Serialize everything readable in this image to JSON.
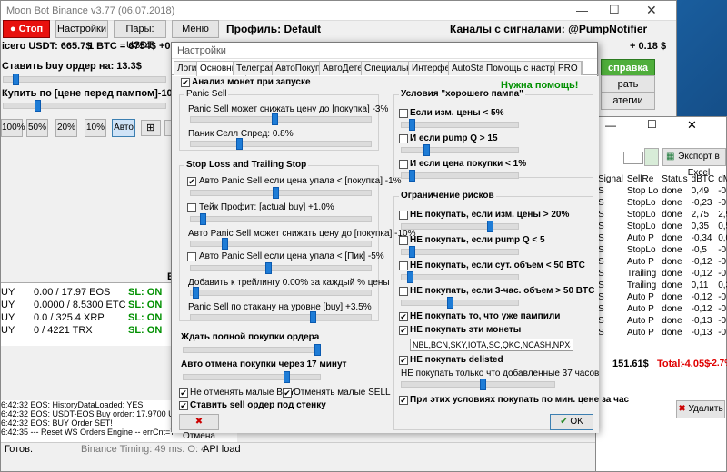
{
  "main": {
    "title": "Moon Bot Binance v3.77 (06.07.2018)",
    "stop_label": "Стоп",
    "settings_label": "Настройки",
    "pairs_label": "Пары: USDT",
    "menu_label": "Меню",
    "profile": "Профиль: Default",
    "signals": "Каналы с сигналами: @PumpNotifier",
    "balance": "icero USDT: 665.7$",
    "btc_rate": "1 BTC = 6754$ +0.0%",
    "right_top": "+ 0.18 $",
    "buy_order": "Ставить buy ордер на: 13.3$",
    "buy_price": "Купить по [цене перед пампом]-10.0%",
    "pct_buttons": [
      "100%",
      "50%",
      "20%",
      "10%",
      "Авто"
    ],
    "right_buttons": [
      "справка",
      "рать маркеты",
      "атегии"
    ],
    "side_letter": "E",
    "positions": [
      {
        "side": "UY",
        "amount": "0.00 / 17.97 EOS",
        "sl": "SL: ON"
      },
      {
        "side": "UY",
        "amount": "0.0000 / 8.5300 ETC",
        "sl": "SL: ON"
      },
      {
        "side": "UY",
        "amount": "0.0 / 325.4 XRP",
        "sl": "SL: ON"
      },
      {
        "side": "UY",
        "amount": "0 / 4221 TRX",
        "sl": "SL: ON"
      }
    ],
    "log": [
      "6:42:32 EOS: HistoryDataLoaded: YES",
      "6:42:32 EOS: USDT-EOS Buy order: 17.9700 USDT-EOS ra",
      "6:42:32 EOS: BUY Order SET!",
      "6:42:35 --- Reset WS Orders Engine -- errCnt=7"
    ],
    "status_ready": "Готов.",
    "timing": "Binance Timing: 49 ms.  O: 4",
    "api": "API load"
  },
  "dialog": {
    "title": "Настройки",
    "tabs": [
      "Логин",
      "Основные",
      "Телеграм",
      "АвтоПокупка",
      "АвтоДетект",
      "Специальные",
      "Интерфейс",
      "AutoStart",
      "Помощь с настройкой",
      "PRO"
    ],
    "active_tab": "Основные",
    "analyze": "Анализ монет при запуске",
    "need_help": "Нужна помощь!",
    "panic_sell_group": "Panic Sell",
    "panic_lower": "Panic Sell может снижать цену до [покупка] -3%",
    "panic_spread": "Паник Селл Спред: 0.8%",
    "sl_group": "Stop Loss and Trailing Stop",
    "auto_panic_1": "Авто Panic Sell если цена упала < [покупка] -1%",
    "take_profit": "Тейк Профит: [actual buy] +1.0%",
    "auto_panic_lower": "Авто Panic Sell может снижать цену до [покупка] -10%",
    "auto_panic_2": "Авто Panic Sell если цена упала < [Пик] -5%",
    "trailing_add": "Добавить к трейлингу 0.00% за каждый % цены",
    "panic_glass": "Panic Sell по стакану на уровне [buy] +3.5%",
    "wait_full": "Ждать полной покупки ордера",
    "auto_cancel": "Авто отмена покупки через 17 минут",
    "no_cancel_buy": "Не отменять малые BUY",
    "cancel_sell": "Отменять малые SELL",
    "sell_wall": "Ставить sell ордер под стенку",
    "good_pump": "Условия \"хорошего пампа\"",
    "if_change": "Если изм. цены < 5%",
    "if_pump": "И если pump Q > 15",
    "if_price": "И если цена покупки < 1%",
    "risk_group": "Ограничение рисков",
    "no_buy_change": "НЕ покупать, если изм. цены  > 20%",
    "no_buy_pump": "НЕ покупать, если pump Q < 5",
    "no_buy_vol": "НЕ покупать, если сут. объем < 50 BTC",
    "no_buy_3h": "НЕ покупать, если 3-час. объем > 50 BTC",
    "no_buy_pumped": "НЕ покупать то, что уже пампили",
    "no_buy_these": "НЕ покупать эти монеты",
    "coins": "NBL,BCN,SKY,IOTA,SC,QKC,NCASH,NPXS,KEY",
    "no_delisted": "НЕ покупать delisted",
    "only_new": "НЕ покупать только что добавленные 37 часов",
    "min_price": "При этих условиях покупать по мин. цене за час",
    "cancel_label": "Отмена",
    "ok_label": "OK"
  },
  "right_window": {
    "export_label": "Экспорт в Excel",
    "headers": [
      "Signal",
      "SellRe",
      "Status",
      "dBTC",
      "dMarke"
    ],
    "rows": [
      [
        "S",
        "Stop Lo",
        "done",
        "0,49",
        "-0,37"
      ],
      [
        "S",
        "StopLo",
        "done",
        "-0,23",
        "-0,37"
      ],
      [
        "S",
        "StopLo",
        "done",
        "2,75",
        "2,99"
      ],
      [
        "S",
        "StopLo",
        "done",
        "0,35",
        "0,57"
      ],
      [
        "S",
        "Auto P",
        "done",
        "-0,34",
        "0,03"
      ],
      [
        "S",
        "StopLo",
        "done",
        "-0,5",
        "-0,52"
      ],
      [
        "S",
        "Auto P",
        "done",
        "-0,12",
        "-0,12"
      ],
      [
        "S",
        "Trailing",
        "done",
        "-0,12",
        "-0,12"
      ],
      [
        "S",
        "Trailing",
        "done",
        "0,11",
        "0,38"
      ],
      [
        "S",
        "Auto P",
        "done",
        "-0,12",
        "-0,12"
      ],
      [
        "S",
        "Auto P",
        "done",
        "-0,12",
        "-0,12"
      ],
      [
        "S",
        "Auto P",
        "done",
        "-0,13",
        "-0,12"
      ],
      [
        "S",
        "Auto P",
        "done",
        "-0,13",
        "-0,12"
      ]
    ],
    "total_left": "151.61$",
    "total_label": "Total:",
    "total_value": "-4.05$",
    "total_pct": "-2.7%",
    "delete_label": "Удалить"
  }
}
